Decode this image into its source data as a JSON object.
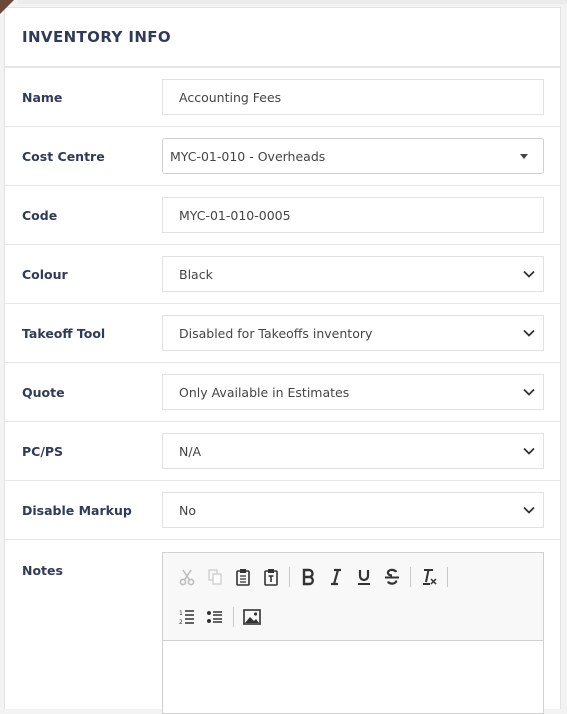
{
  "panel": {
    "title": "INVENTORY INFO"
  },
  "fields": {
    "name": {
      "label": "Name",
      "value": "Accounting Fees"
    },
    "cost_centre": {
      "label": "Cost Centre",
      "value": "MYC-01-010 - Overheads"
    },
    "code": {
      "label": "Code",
      "value": "MYC-01-010-0005"
    },
    "colour": {
      "label": "Colour",
      "value": "Black"
    },
    "takeoff_tool": {
      "label": "Takeoff Tool",
      "value": "Disabled for Takeoffs inventory"
    },
    "quote": {
      "label": "Quote",
      "value": "Only Available in Estimates"
    },
    "pcps": {
      "label": "PC/PS",
      "value": "N/A"
    },
    "disable_markup": {
      "label": "Disable Markup",
      "value": "No"
    },
    "notes": {
      "label": "Notes"
    }
  },
  "editor_toolbar": {
    "icons": [
      "cut-icon",
      "copy-icon",
      "paste-icon",
      "paste-text-icon",
      "bold-icon",
      "italic-icon",
      "underline-icon",
      "strikethrough-icon",
      "remove-format-icon",
      "numbered-list-icon",
      "bulleted-list-icon",
      "image-icon"
    ]
  },
  "colors": {
    "label": "#2f3b59",
    "corner": "#6b4a3a",
    "border": "#e2e2e2"
  }
}
